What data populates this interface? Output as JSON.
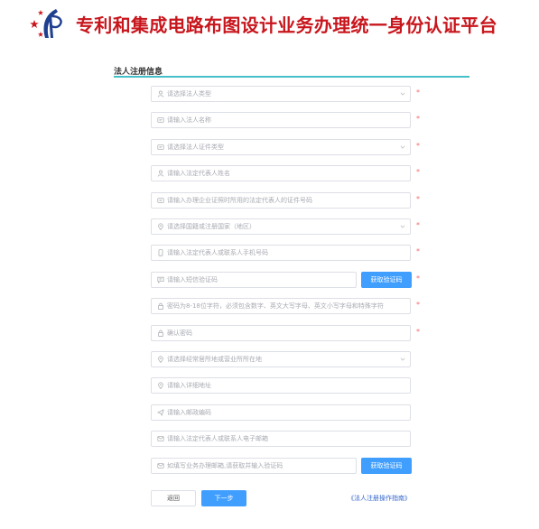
{
  "header": {
    "title": "专利和集成电路布图设计业务办理统一身份认证平台",
    "brand_color": "#c8161d"
  },
  "form": {
    "section_title": "法人注册信息",
    "fields": [
      {
        "placeholder": "请选择法人类型",
        "icon": "user-icon",
        "dropdown": true,
        "required": true
      },
      {
        "placeholder": "请输入法人名称",
        "icon": "id-card-icon",
        "dropdown": false,
        "required": true
      },
      {
        "placeholder": "请选择法人证件类型",
        "icon": "id-card-icon",
        "dropdown": true,
        "required": true
      },
      {
        "placeholder": "请输入法定代表人姓名",
        "icon": "user-icon",
        "dropdown": false,
        "required": true
      },
      {
        "placeholder": "请输入办理企业证照时所用的法定代表人的证件号码",
        "icon": "id-card-icon",
        "dropdown": false,
        "required": true
      },
      {
        "placeholder": "请选择国籍或注册国家（地区）",
        "icon": "location-icon",
        "dropdown": true,
        "required": true
      },
      {
        "placeholder": "请输入法定代表人或联系人手机号码",
        "icon": "phone-icon",
        "dropdown": false,
        "required": true
      },
      {
        "placeholder": "请输入短信验证码",
        "icon": "message-icon",
        "dropdown": false,
        "required": true,
        "button": "获取验证码"
      },
      {
        "placeholder": "密码为8-18位字符，必须包含数字、英文大写字母、英文小写字母和特殊字符",
        "icon": "lock-icon",
        "dropdown": false,
        "required": true
      },
      {
        "placeholder": "确认密码",
        "icon": "lock-icon",
        "dropdown": false,
        "required": true
      },
      {
        "placeholder": "请选择经常居所地或营业所所在地",
        "icon": "location-icon",
        "dropdown": true,
        "required": false
      },
      {
        "placeholder": "请输入详细地址",
        "icon": "location-icon",
        "dropdown": false,
        "required": false
      },
      {
        "placeholder": "请输入邮政编码",
        "icon": "send-icon",
        "dropdown": false,
        "required": false
      },
      {
        "placeholder": "请输入法定代表人或联系人电子邮箱",
        "icon": "mail-icon",
        "dropdown": false,
        "required": false
      },
      {
        "placeholder": "如填写业务办理邮箱,请获取并输入验证码",
        "icon": "mail-icon",
        "dropdown": false,
        "required": false,
        "button": "获取验证码"
      }
    ],
    "required_mark": "*",
    "back_label": "返回",
    "next_label": "下一步",
    "guide_link": "《法人注册操作指南》",
    "accent_color": "#409eff"
  }
}
